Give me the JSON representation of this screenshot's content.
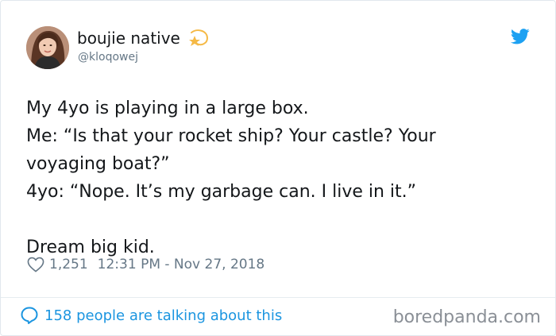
{
  "author": {
    "display_name": "boujie native",
    "handle": "@kloqowej",
    "name_emoji": "dizzy-star-icon"
  },
  "tweet": {
    "lines": [
      "My 4yo is playing in a large box.",
      "Me: “Is that your rocket ship? Your castle? Your",
      "voyaging boat?”",
      "4yo: “Nope. It’s my garbage can. I live in it.”",
      "",
      "Dream big kid."
    ]
  },
  "meta": {
    "likes": "1,251",
    "timestamp": "12:31 PM - Nov 27, 2018"
  },
  "footer": {
    "talking_label": "158 people are talking about this"
  },
  "watermark": "boredpanda.com",
  "colors": {
    "twitter_blue": "#1da1f2",
    "link_blue": "#1b95e0",
    "meta_gray": "#657786",
    "text": "#14171a"
  }
}
